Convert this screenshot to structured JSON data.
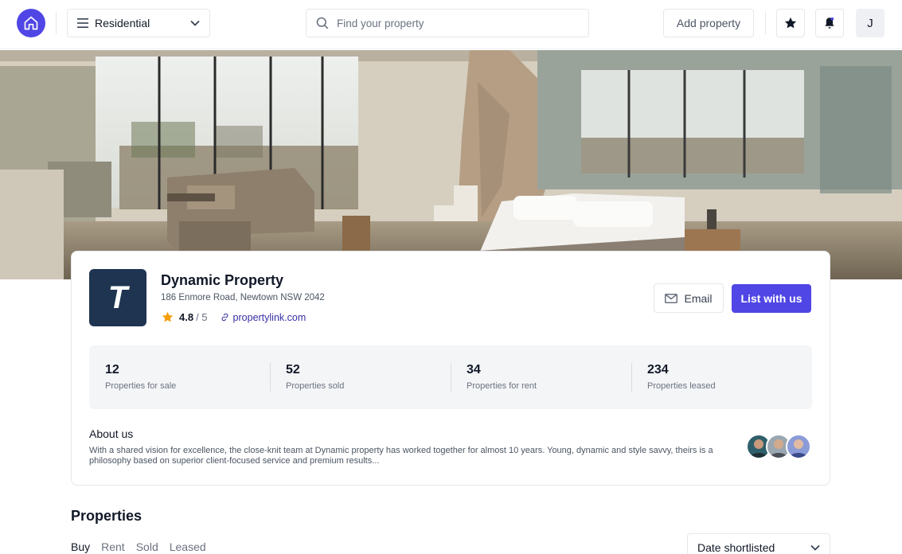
{
  "topbar": {
    "category": "Residential",
    "search_placeholder": "Find your property",
    "add_property": "Add property",
    "user_initial": "J"
  },
  "agency": {
    "logo_letter": "T",
    "name": "Dynamic Property",
    "address": "186 Enmore Road, Newtown NSW 2042",
    "rating": "4.8",
    "rating_max": "/ 5",
    "website": "propertylink.com",
    "email_label": "Email",
    "list_label": "List with us"
  },
  "stats": [
    {
      "value": "12",
      "label": "Properties for sale"
    },
    {
      "value": "52",
      "label": "Properties sold"
    },
    {
      "value": "34",
      "label": "Properties for rent"
    },
    {
      "value": "234",
      "label": "Properties leased"
    }
  ],
  "about": {
    "title": "About us",
    "text": "With a shared vision for excellence, the close-knit team at Dynamic property has worked together for almost 10 years. Young, dynamic and style savvy, theirs is a philosophy based on superior client-focused service and premium results..."
  },
  "properties": {
    "title": "Properties",
    "tabs": [
      "Buy",
      "Rent",
      "Sold",
      "Leased"
    ],
    "sort": "Date shortlisted"
  },
  "colors": {
    "accent": "#4f46e5",
    "logo_bg": "#1e3450",
    "star": "#f59e0b"
  }
}
